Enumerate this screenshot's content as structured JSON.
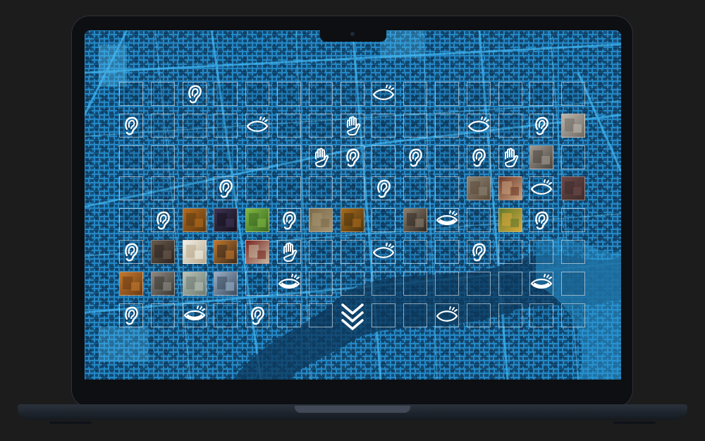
{
  "colors": {
    "map_blue": "#1e7fbd",
    "map_dark": "#0f3b5e",
    "icon_white": "#ffffff",
    "device_body": "#0d0f12",
    "background": "#1c1c1d"
  },
  "grid": {
    "rows": 8,
    "cols": 15,
    "cells": [
      [
        "",
        "",
        "ear",
        "",
        "",
        "",
        "",
        "",
        "eye-open",
        "",
        "",
        "",
        "",
        "",
        ""
      ],
      [
        "ear",
        "",
        "",
        "",
        "eye-open",
        "",
        "",
        "hand",
        "",
        "",
        "",
        "eye-open",
        "",
        "ear",
        "photo-gray"
      ],
      [
        "",
        "",
        "",
        "",
        "",
        "",
        "hand",
        "ear",
        "",
        "ear",
        "",
        "ear",
        "hand",
        "photo-figure",
        ""
      ],
      [
        "",
        "",
        "",
        "ear",
        "",
        "",
        "",
        "",
        "ear",
        "",
        "",
        "photo-building",
        "photo-house",
        "eye-open",
        "photo-red"
      ],
      [
        "",
        "ear",
        "photo-orange",
        "photo-purple",
        "photo-green",
        "ear",
        "photo-tree",
        "photo-amber",
        "",
        "photo-doorway",
        "eye-closed",
        "",
        "photo-flowers",
        "ear",
        ""
      ],
      [
        "ear",
        "photo-room",
        "photo-bright",
        "photo-street",
        "photo-red-door",
        "hand",
        "",
        "",
        "eye-open",
        "",
        "",
        "ear",
        "",
        "",
        ""
      ],
      [
        "photo-leaf",
        "photo-alley",
        "photo-sculpture",
        "photo-bridge",
        "",
        "eye-closed",
        "",
        "",
        "",
        "",
        "",
        "",
        "",
        "eye-closed",
        ""
      ],
      [
        "ear",
        "",
        "eye-closed",
        "",
        "ear",
        "",
        "",
        "",
        "",
        "",
        "eye-open",
        "",
        "",
        "",
        ""
      ]
    ]
  },
  "photo_colors": {
    "photo-gray": [
      "#bdb7ad",
      "#6f6a63"
    ],
    "photo-figure": [
      "#a29a90",
      "#4a4540"
    ],
    "photo-building": [
      "#8a8272",
      "#5c4a3a"
    ],
    "photo-house": [
      "#6e3a2c",
      "#c8a17c"
    ],
    "photo-red": [
      "#6d4848",
      "#3d2c2c"
    ],
    "photo-orange": [
      "#b36a1c",
      "#5d3a12"
    ],
    "photo-purple": [
      "#3d3355",
      "#15121d"
    ],
    "photo-green": [
      "#7fb543",
      "#3b6a22"
    ],
    "photo-tree": [
      "#7d6a4a",
      "#a49370"
    ],
    "photo-amber": [
      "#a86b1a",
      "#4d3410"
    ],
    "photo-doorway": [
      "#8c7d6a",
      "#2f2a25"
    ],
    "photo-flowers": [
      "#5f7a2c",
      "#d8a83a"
    ],
    "photo-room": [
      "#6a5a4c",
      "#2c2520"
    ],
    "photo-bright": [
      "#f2f0ea",
      "#b9a98a"
    ],
    "photo-street": [
      "#c2772c",
      "#3a2a1c"
    ],
    "photo-red-door": [
      "#7a2420",
      "#c5b8a0"
    ],
    "photo-leaf": [
      "#c27a2e",
      "#6b3a14"
    ],
    "photo-alley": [
      "#8e8a82",
      "#3a3632"
    ],
    "photo-sculpture": [
      "#b8c2b6",
      "#6e7a72"
    ],
    "photo-bridge": [
      "#9ab0c8",
      "#3a4a5c"
    ]
  },
  "icons": {
    "scroll": "chevron-double-down-icon"
  }
}
